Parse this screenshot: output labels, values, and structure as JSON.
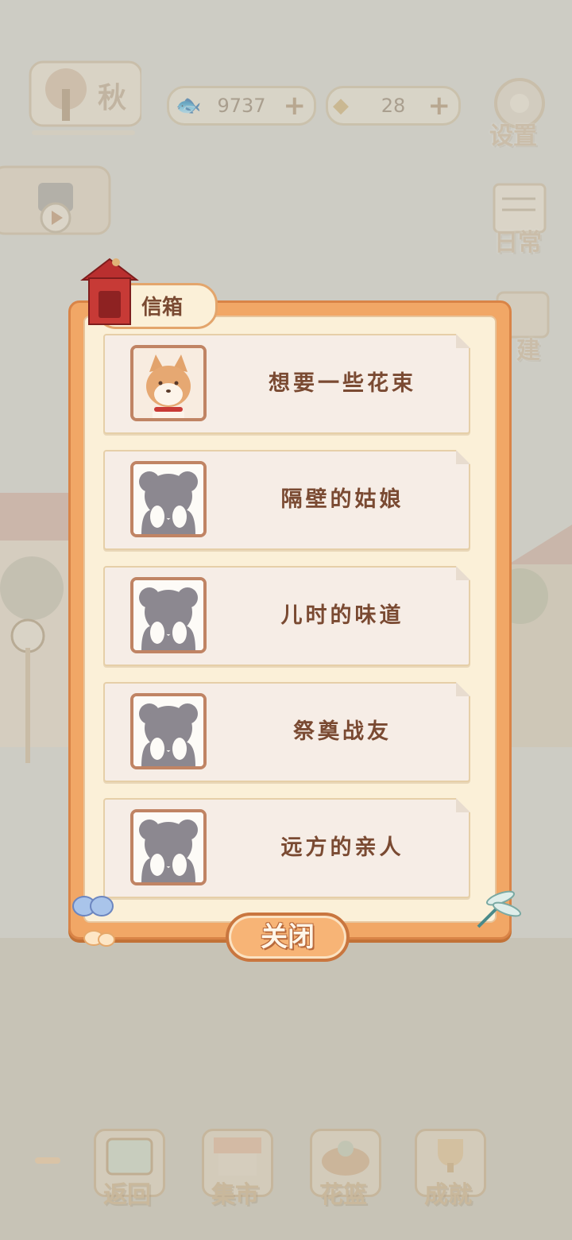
{
  "hud": {
    "season": "秋",
    "fish_count": "9737",
    "cheese_count": "28",
    "settings_label": "设置",
    "daily_label": "日常",
    "build_label": "建"
  },
  "mailbox": {
    "title": "信箱",
    "letters": [
      {
        "title": "想要一些花束",
        "unlocked": true,
        "portrait": "shiba-dog-icon"
      },
      {
        "title": "隔壁的姑娘",
        "unlocked": false,
        "portrait": "silhouette-icon"
      },
      {
        "title": "儿时的味道",
        "unlocked": false,
        "portrait": "silhouette-icon"
      },
      {
        "title": "祭奠战友",
        "unlocked": false,
        "portrait": "silhouette-icon"
      },
      {
        "title": "远方的亲人",
        "unlocked": false,
        "portrait": "silhouette-icon"
      }
    ],
    "close_label": "关闭"
  },
  "bottom_nav": [
    {
      "label": "返回"
    },
    {
      "label": "集市"
    },
    {
      "label": "花篮"
    },
    {
      "label": "成就"
    }
  ],
  "colors": {
    "modal_frame": "#f1a766",
    "modal_inner": "#fbf0d8",
    "text_brown": "#7a4a32",
    "silhouette": "#8c8890"
  }
}
